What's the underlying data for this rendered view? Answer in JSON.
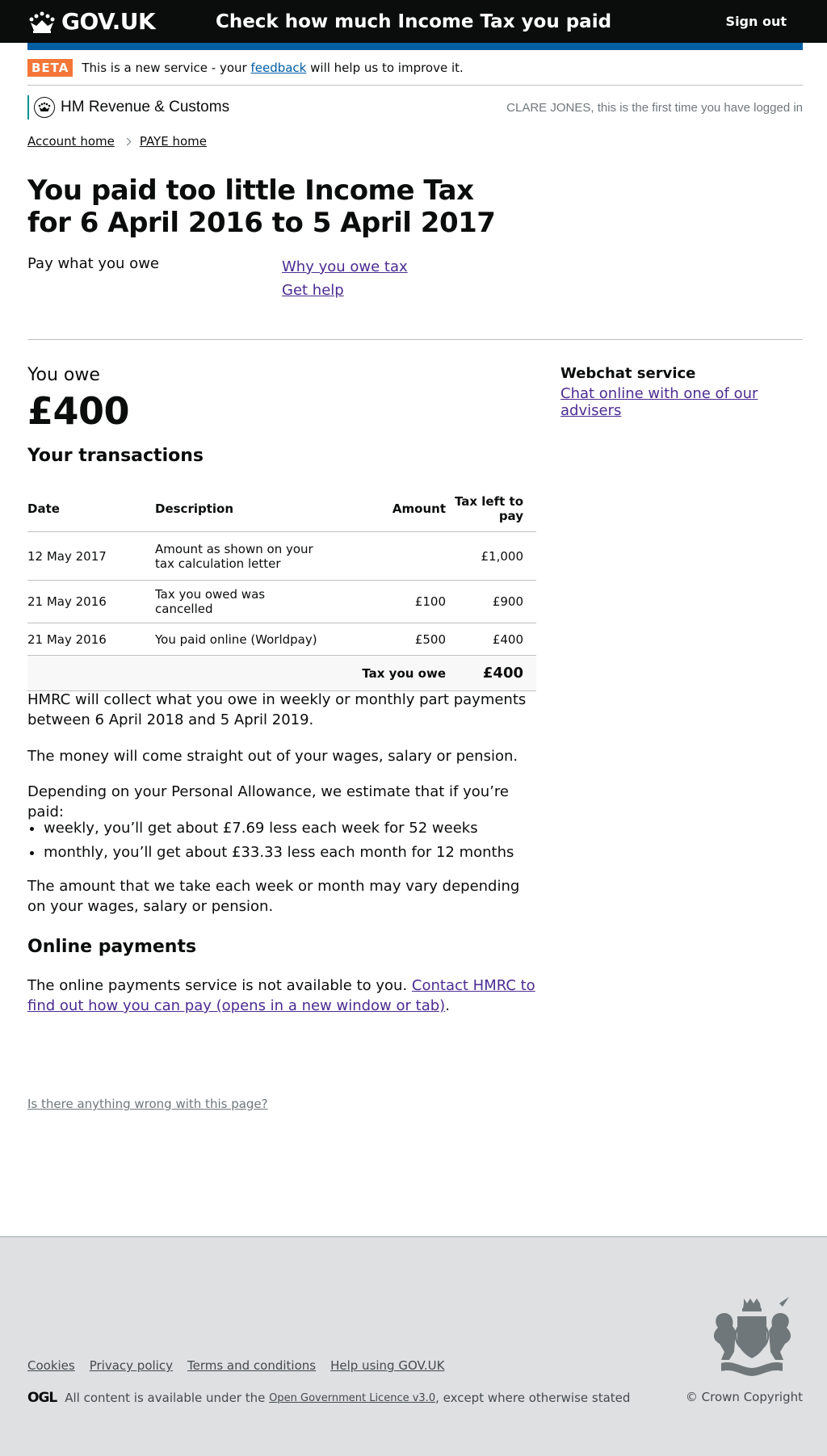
{
  "header": {
    "logo_text": "GOV.UK",
    "service_name": "Check how much Income Tax you paid",
    "sign_out": "Sign out"
  },
  "phase_banner": {
    "tag": "BETA",
    "text_before": "This is a new service - your",
    "link": "feedback",
    "text_after": "will help us to improve it."
  },
  "hmrc": {
    "brand": "HM Revenue & Customs",
    "login_message": "CLARE JONES, this is the first time you have logged in"
  },
  "breadcrumbs": [
    {
      "label": "Account home"
    },
    {
      "label": "PAYE home"
    }
  ],
  "page": {
    "title": "You paid too little Income Tax for 6 April 2016 to 5 April 2017",
    "pay_label": "Pay what you owe",
    "links": [
      "Why you owe tax",
      "Get help"
    ]
  },
  "owe": {
    "label": "You owe",
    "amount": "£400"
  },
  "transactions": {
    "heading": "Your transactions",
    "columns": [
      "Date",
      "Description",
      "Amount",
      "Tax left to pay"
    ],
    "rows": [
      {
        "date": "12 May 2017",
        "description": "Amount as shown on your tax calculation letter",
        "amount": "",
        "left": "£1,000"
      },
      {
        "date": "21 May 2016",
        "description": "Tax you owed was cancelled",
        "amount": "£100",
        "left": "£900"
      },
      {
        "date": "21 May 2016",
        "description": "You paid online (Worldpay)",
        "amount": "£500",
        "left": "£400"
      }
    ],
    "total_label": "Tax you owe",
    "total_amount": "£400"
  },
  "content": {
    "p1": "HMRC will collect what you owe in weekly or monthly part payments between 6 April 2018 and 5 April 2019.",
    "p2": "The money will come straight out of your wages, salary or pension.",
    "p3": "Depending on your Personal Allowance, we estimate that if you’re paid:",
    "bullets": [
      "weekly, you’ll get about £7.69 less each week for 52 weeks",
      "monthly, you’ll get about £33.33 less each month for 12 months"
    ],
    "p4": "The amount that we take each week or month may vary depending on your wages, salary or pension.",
    "online_heading": "Online payments",
    "p5_text": "The online payments service is not available to you.",
    "p5_link": "Contact HMRC to find out how you can pay (opens in a new window or tab)",
    "p5_end": "."
  },
  "sidebar": {
    "heading": "Webchat service",
    "link": "Chat online with one of our advisers"
  },
  "report_link": "Is there anything wrong with this page?",
  "footer": {
    "links": [
      "Cookies",
      "Privacy policy",
      "Terms and conditions",
      "Help using GOV.UK"
    ],
    "ogl": "OGL",
    "licence_before": "All content is available under the",
    "licence_link": "Open Government Licence v3.0",
    "licence_after": ", except where otherwise stated",
    "copyright": "© Crown Copyright"
  }
}
